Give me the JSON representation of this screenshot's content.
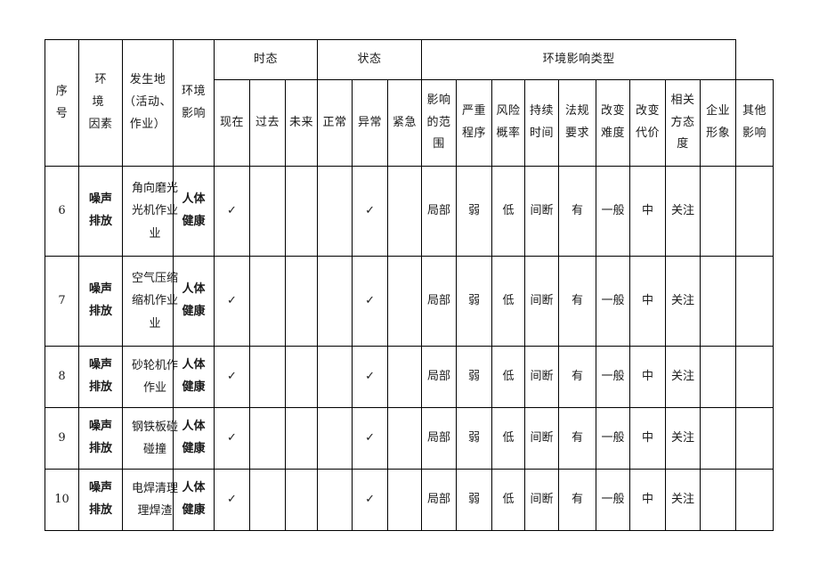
{
  "document": {
    "type": "environmental-impact-factor-table",
    "title": ""
  },
  "table": {
    "header": {
      "col_seq": {
        "lines": [
          "序",
          "号"
        ]
      },
      "col_factor": {
        "lines": [
          "环  境",
          "因素"
        ]
      },
      "col_location": {
        "lines": [
          "发生地",
          "（活动、",
          "作业）"
        ]
      },
      "col_impact": {
        "lines": [
          "环境",
          "影响"
        ]
      },
      "group_tense": {
        "label": "时态"
      },
      "group_state": {
        "label": "状态"
      },
      "group_impact_type": {
        "label": "环境影响类型"
      },
      "sub": {
        "now": "现在",
        "past": "过去",
        "future": "未来",
        "normal": "正常",
        "abnormal": "异常",
        "emergency": "紧急",
        "scope": {
          "lines": [
            "影响",
            "的范",
            "围"
          ]
        },
        "severity": {
          "lines": [
            "严重",
            "程序"
          ]
        },
        "risk": {
          "lines": [
            "风险",
            "概率"
          ]
        },
        "duration": {
          "lines": [
            "持续",
            "时间"
          ]
        },
        "regulation": {
          "lines": [
            "法规",
            "要求"
          ]
        },
        "change_difficulty": {
          "lines": [
            "改变",
            "难度"
          ]
        },
        "change_cost": {
          "lines": [
            "改变",
            "代价"
          ]
        },
        "stakeholder": {
          "lines": [
            "相关",
            "方态",
            "度"
          ]
        },
        "corporate_image": {
          "lines": [
            "企业",
            "形象"
          ]
        },
        "other_impact": {
          "lines": [
            "其他",
            "影响"
          ]
        }
      }
    },
    "rows": [
      {
        "seq": "6",
        "factor": [
          "噪声",
          "排放"
        ],
        "location": [
          "角向磨光",
          "光机作业",
          "业"
        ],
        "impact": [
          "人体",
          "健康"
        ],
        "now": "✓",
        "past": "",
        "future": "",
        "normal": "",
        "abnormal": "✓",
        "emergency": "",
        "scope": "局部",
        "severity": "弱",
        "risk": "低",
        "duration": "间断",
        "regulation": "有",
        "change_difficulty": "一般",
        "change_cost": "中",
        "stakeholder": "关注",
        "corporate_image": "",
        "other_impact": ""
      },
      {
        "seq": "7",
        "factor": [
          "噪声",
          "排放"
        ],
        "location": [
          "空气压缩",
          "缩机作业",
          "业"
        ],
        "impact": [
          "人体",
          "健康"
        ],
        "now": "✓",
        "past": "",
        "future": "",
        "normal": "",
        "abnormal": "✓",
        "emergency": "",
        "scope": "局部",
        "severity": "弱",
        "risk": "低",
        "duration": "间断",
        "regulation": "有",
        "change_difficulty": "一般",
        "change_cost": "中",
        "stakeholder": "关注",
        "corporate_image": "",
        "other_impact": ""
      },
      {
        "seq": "8",
        "factor": [
          "噪声",
          "排放"
        ],
        "location": [
          "砂轮机作",
          "作业"
        ],
        "impact": [
          "人体",
          "健康"
        ],
        "now": "✓",
        "past": "",
        "future": "",
        "normal": "",
        "abnormal": "✓",
        "emergency": "",
        "scope": "局部",
        "severity": "弱",
        "risk": "低",
        "duration": "间断",
        "regulation": "有",
        "change_difficulty": "一般",
        "change_cost": "中",
        "stakeholder": "关注",
        "corporate_image": "",
        "other_impact": ""
      },
      {
        "seq": "9",
        "factor": [
          "噪声",
          "排放"
        ],
        "location": [
          "钢铁板碰",
          "碰撞"
        ],
        "impact": [
          "人体",
          "健康"
        ],
        "now": "✓",
        "past": "",
        "future": "",
        "normal": "",
        "abnormal": "✓",
        "emergency": "",
        "scope": "局部",
        "severity": "弱",
        "risk": "低",
        "duration": "间断",
        "regulation": "有",
        "change_difficulty": "一般",
        "change_cost": "中",
        "stakeholder": "关注",
        "corporate_image": "",
        "other_impact": ""
      },
      {
        "seq": "10",
        "factor": [
          "噪声",
          "排放"
        ],
        "location": [
          "电焊清理",
          "理焊渣"
        ],
        "impact": [
          "人体",
          "健康"
        ],
        "now": "✓",
        "past": "",
        "future": "",
        "normal": "",
        "abnormal": "✓",
        "emergency": "",
        "scope": "局部",
        "severity": "弱",
        "risk": "低",
        "duration": "间断",
        "regulation": "有",
        "change_difficulty": "一般",
        "change_cost": "中",
        "stakeholder": "关注",
        "corporate_image": "",
        "other_impact": ""
      }
    ]
  },
  "colors": {
    "border": "#000000",
    "text": "#1a1a1a",
    "background": "#ffffff"
  }
}
